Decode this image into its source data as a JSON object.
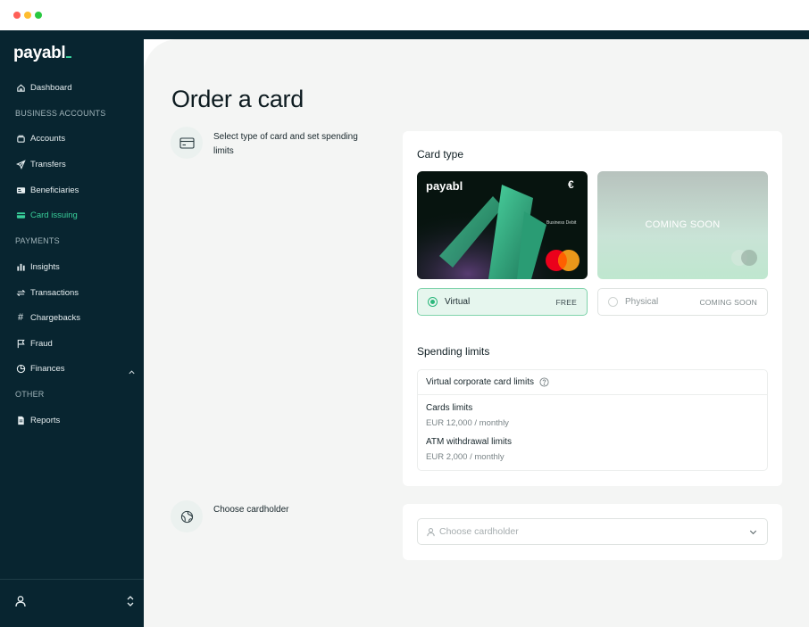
{
  "window": {
    "controls": [
      "close",
      "minimize",
      "maximize"
    ]
  },
  "sidebar": {
    "logo": "payabl",
    "items": [
      {
        "label": "Dashboard",
        "icon": "home-icon"
      },
      {
        "section": "BUSINESS ACCOUNTS"
      },
      {
        "label": "Accounts",
        "icon": "accounts-icon"
      },
      {
        "label": "Transfers",
        "icon": "send-icon"
      },
      {
        "label": "Beneficiaries",
        "icon": "id-card-icon"
      },
      {
        "label": "Card issuing",
        "icon": "card-icon",
        "active": true
      },
      {
        "section": "PAYMENTS"
      },
      {
        "label": "Insights",
        "icon": "bar-chart-icon"
      },
      {
        "label": "Transactions",
        "icon": "arrows-icon"
      },
      {
        "label": "Chargebacks",
        "icon": "hash-icon"
      },
      {
        "label": "Fraud",
        "icon": "flag-icon"
      },
      {
        "label": "Finances",
        "icon": "pie-chart-icon",
        "expanded": true
      },
      {
        "section": "OTHER"
      },
      {
        "label": "Reports",
        "icon": "document-icon"
      }
    ]
  },
  "main": {
    "title": "Order a card",
    "step1": {
      "text": "Select type of card and set spending limits",
      "card_type_heading": "Card type",
      "virtual_card": {
        "logo": "payabl",
        "currency_symbol": "€",
        "caption": "Business Debit"
      },
      "physical_card": {
        "overlay": "COMING SOON"
      },
      "options": [
        {
          "label": "Virtual",
          "tag": "FREE",
          "selected": true
        },
        {
          "label": "Physical",
          "tag": "COMING SOON",
          "selected": false
        }
      ],
      "spending_heading": "Spending limits",
      "limits_title": "Virtual corporate card limits",
      "limits": [
        {
          "label": "Cards limits",
          "value": "EUR 12,000 / monthly"
        },
        {
          "label": "ATM withdrawal limits",
          "value": "EUR 2,000 / monthly"
        }
      ]
    },
    "step2": {
      "text": "Choose cardholder",
      "placeholder": "Choose cardholder"
    }
  },
  "colors": {
    "sidebar_bg": "#082530",
    "accent": "#39d09b",
    "main_bg": "#f4f5f4"
  }
}
